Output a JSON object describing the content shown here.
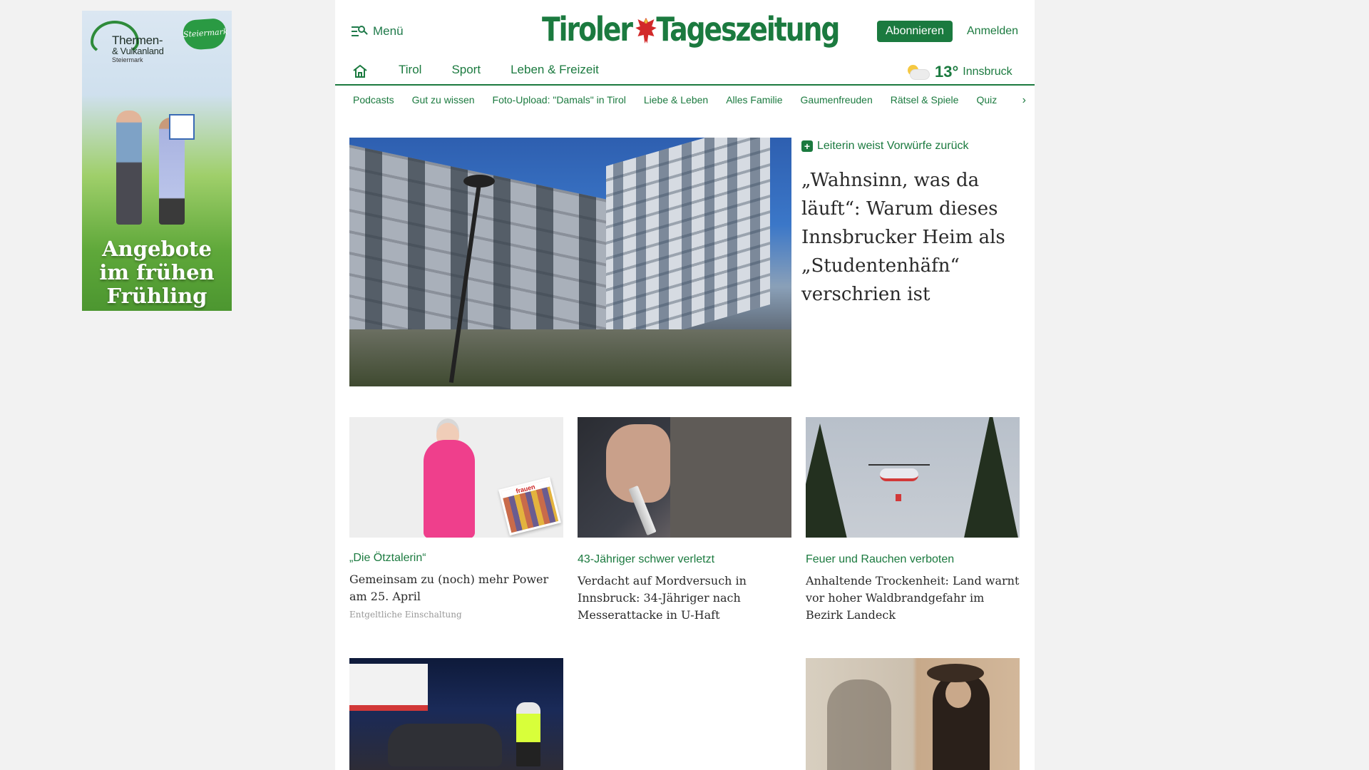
{
  "ad": {
    "brand_line1": "Thermen-",
    "brand_line2": "& Vulkanland",
    "brand_sub": "Steiermark",
    "badge": "Steiermark",
    "headline_line1": "Angebote",
    "headline_line2": "im frühen",
    "headline_line3": "Frühling"
  },
  "header": {
    "menu_label": "Menü",
    "logo_left": "Tiroler",
    "logo_right": "Tageszeitung",
    "subscribe_label": "Abonnieren",
    "login_label": "Anmelden"
  },
  "nav": {
    "items": [
      "Tirol",
      "Sport",
      "Leben & Freizeit"
    ],
    "weather": {
      "temp": "13°",
      "city": "Innsbruck"
    }
  },
  "subnav": {
    "items": [
      "Podcasts",
      "Gut zu wissen",
      "Foto-Upload: \"Damals\" in Tirol",
      "Liebe & Leben",
      "Alles Familie",
      "Gaumenfreuden",
      "Rätsel & Spiele",
      "Quiz"
    ]
  },
  "hero": {
    "kicker": "Leiterin weist Vorwürfe zurück",
    "title": "„Wahnsinn, was da läuft“: Warum dieses Innsbrucker Heim als „Studentenhäfn“ verschrien ist"
  },
  "cards": [
    {
      "kicker": "„Die Ötztalerin“",
      "title": "Gemeinsam zu (noch) mehr Power am 25. April",
      "note": "Entgeltliche Einschaltung",
      "magazine": "frauen"
    },
    {
      "kicker": "43-Jähriger schwer verletzt",
      "title": "Verdacht auf Mordversuch in Innsbruck: 34-Jähriger nach Messerattacke in U-Haft"
    },
    {
      "kicker": "Feuer und Rauchen verboten",
      "title": "Anhaltende Trockenheit: Land warnt vor hoher Waldbrandgefahr im Bezirk Landeck"
    }
  ],
  "colors": {
    "brand": "#1b7a3f",
    "page_bg": "#f2f2f2"
  }
}
